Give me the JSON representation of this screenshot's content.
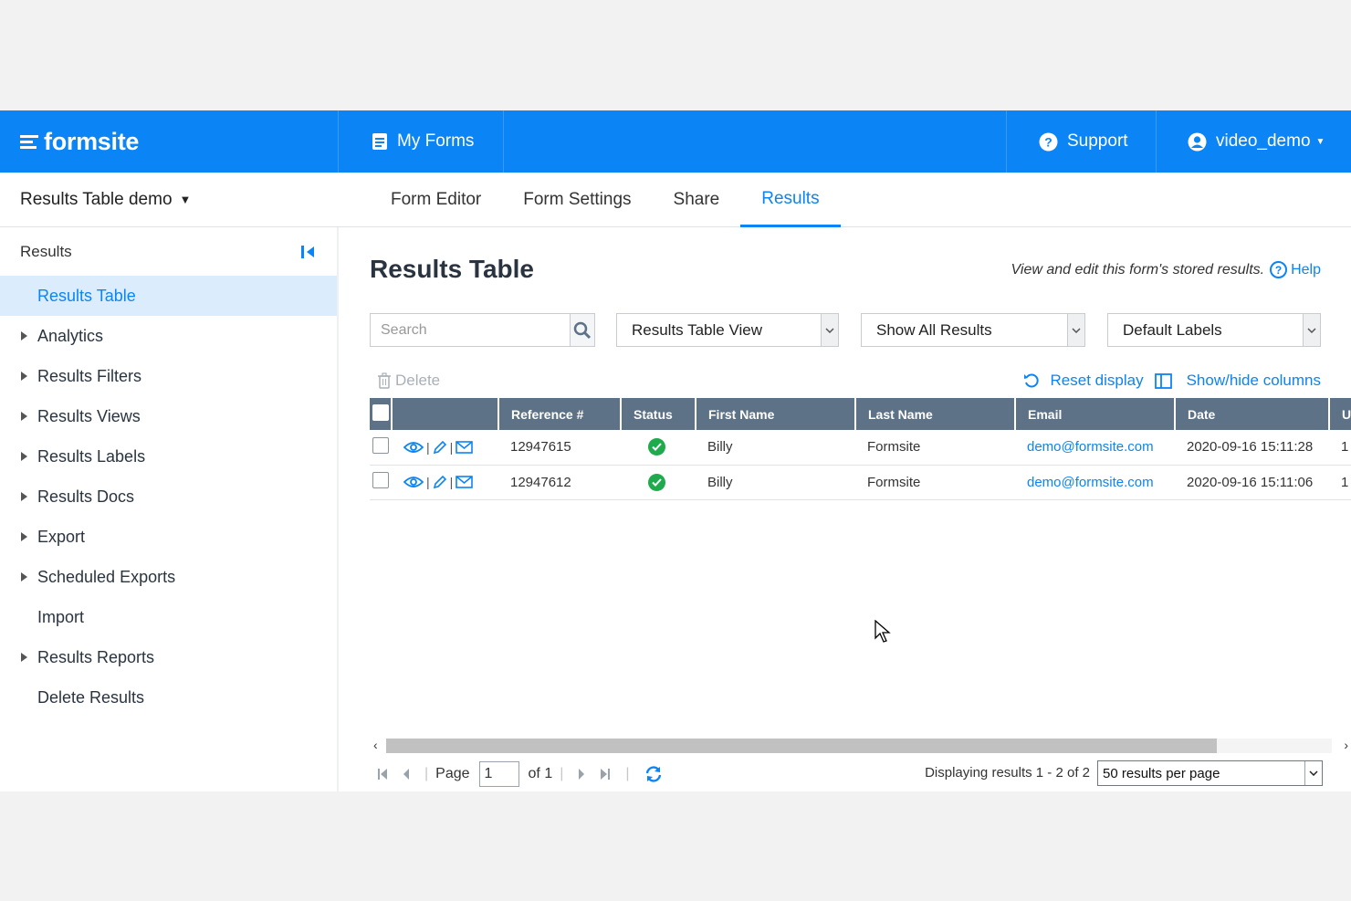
{
  "brand": {
    "name": "formsite"
  },
  "topnav": {
    "my_forms": "My Forms",
    "support": "Support",
    "user": "video_demo"
  },
  "form": {
    "title": "Results Table demo"
  },
  "tabs": [
    "Form Editor",
    "Form Settings",
    "Share",
    "Results"
  ],
  "active_tab": "Results",
  "sidebar": {
    "heading": "Results",
    "items": [
      {
        "label": "Results Table",
        "active": true,
        "expandable": false
      },
      {
        "label": "Analytics",
        "expandable": true
      },
      {
        "label": "Results Filters",
        "expandable": true
      },
      {
        "label": "Results Views",
        "expandable": true
      },
      {
        "label": "Results Labels",
        "expandable": true
      },
      {
        "label": "Results Docs",
        "expandable": true
      },
      {
        "label": "Export",
        "expandable": true
      },
      {
        "label": "Scheduled Exports",
        "expandable": true
      },
      {
        "label": "Import",
        "expandable": false
      },
      {
        "label": "Results Reports",
        "expandable": true
      },
      {
        "label": "Delete Results",
        "expandable": false
      }
    ]
  },
  "main": {
    "title": "Results Table",
    "hint": "View and edit this form's stored results.",
    "help": "Help",
    "search_placeholder": "Search",
    "view_select": "Results Table View",
    "filter_select": "Show All Results",
    "labels_select": "Default Labels",
    "delete": "Delete",
    "reset_display": "Reset display",
    "show_hide_columns": "Show/hide columns"
  },
  "table": {
    "columns": [
      "Reference #",
      "Status",
      "First Name",
      "Last Name",
      "Email",
      "Date",
      "U"
    ],
    "rows": [
      {
        "ref": "12947615",
        "first": "Billy",
        "last": "Formsite",
        "email": "demo@formsite.com",
        "date": "2020-09-16 15:11:28",
        "extra": "1"
      },
      {
        "ref": "12947612",
        "first": "Billy",
        "last": "Formsite",
        "email": "demo@formsite.com",
        "date": "2020-09-16 15:11:06",
        "extra": "1"
      }
    ]
  },
  "pager": {
    "page_label": "Page",
    "page_value": "1",
    "of_label": "of 1",
    "displaying": "Displaying results 1 - 2 of 2",
    "per_page": "50 results per page"
  },
  "colors": {
    "brand_blue": "#0b84f5",
    "header_gray": "#5d7286",
    "success_green": "#1faa4e"
  }
}
